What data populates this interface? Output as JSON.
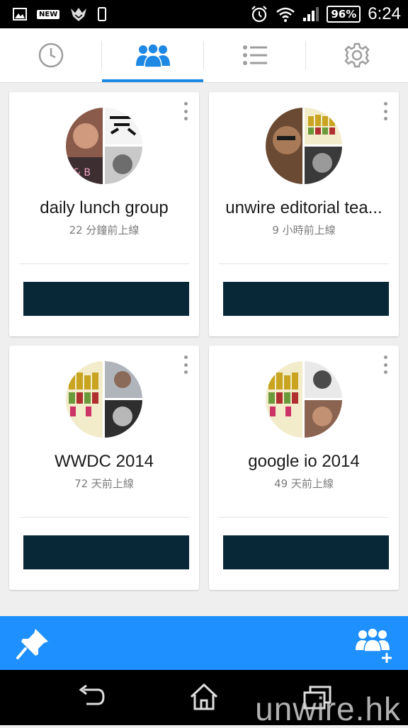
{
  "status_bar": {
    "new_badge": "NEW",
    "battery": "96%",
    "time": "6:24",
    "left_icons": [
      "image-icon",
      "new-badge",
      "game-emblem-icon",
      "phone-icon"
    ],
    "right_icons": [
      "alarm-icon",
      "wifi-icon",
      "signal-icon",
      "battery-icon"
    ]
  },
  "tabs": [
    {
      "icon": "clock-icon",
      "selected": false
    },
    {
      "icon": "groups-icon",
      "selected": true
    },
    {
      "icon": "list-icon",
      "selected": false
    },
    {
      "icon": "settings-icon",
      "selected": false
    }
  ],
  "groups": [
    {
      "name": "daily lunch group",
      "last_online": "22 分鐘前上線"
    },
    {
      "name": "unwire editorial tea...",
      "last_online": "9 小時前上線"
    },
    {
      "name": "WWDC 2014",
      "last_online": "72 天前上線"
    },
    {
      "name": "google io 2014",
      "last_online": "49 天前上線"
    }
  ],
  "action_bar": {
    "left_icon": "pin-icon",
    "right_icon": "add-group-icon"
  },
  "nav_bar": {
    "icons": [
      "back-icon",
      "home-icon",
      "recent-apps-icon"
    ]
  },
  "watermark": "unwire.hk",
  "colors": {
    "accent": "#1e90ff",
    "tab_indicator": "#1e88e5",
    "card_button": "#082737"
  }
}
